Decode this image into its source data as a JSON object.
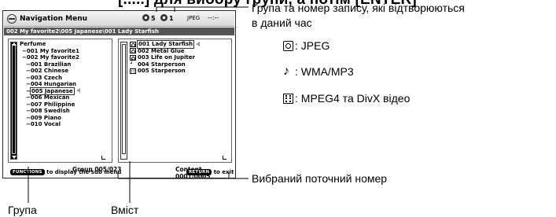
{
  "header_clip": "[.....] для вибору групи, а потім [ENTER]",
  "screen": {
    "title": "Navigation Menu",
    "group_count": "5",
    "track_count": "1",
    "format": "JPEG",
    "time": "--:--",
    "path": "002 My favorite2\\005 Japanese\\001 Lady Starfish",
    "groups": [
      {
        "label": "Perfume",
        "level": 0
      },
      {
        "label": "001 My favorite1",
        "level": 1
      },
      {
        "label": "002 My favorite2",
        "level": 1
      },
      {
        "label": "001 Brazilian",
        "level": 2
      },
      {
        "label": "002 Chinese",
        "level": 2
      },
      {
        "label": "003 Czech",
        "level": 2
      },
      {
        "label": "004 Hungarian",
        "level": 2
      },
      {
        "label": "005 Japanese",
        "level": 2,
        "selected": true
      },
      {
        "label": "006 Mexican",
        "level": 2
      },
      {
        "label": "007 Philippine",
        "level": 2
      },
      {
        "label": "008 Swedish",
        "level": 2
      },
      {
        "label": "009 Piano",
        "level": 2
      },
      {
        "label": "010 Vocal",
        "level": 2
      }
    ],
    "contents": [
      {
        "label": "001 Lady Starfish",
        "type": "jpeg",
        "selected": true
      },
      {
        "label": "002 Metal Glue",
        "type": "jpeg"
      },
      {
        "label": "003 Life on Jupiter",
        "type": "jpeg"
      },
      {
        "label": "004 Starperson",
        "type": "audio"
      },
      {
        "label": "005 Starperson",
        "type": "video"
      }
    ],
    "group_status": "Group 005/023",
    "content_status": "Content 0001/0005",
    "functions_key": "FUNCTIONS",
    "functions_text": "to display the sub menu",
    "return_key": "RETURN",
    "return_text": "to exit"
  },
  "annotations": {
    "playing_line1": "Група та номер запису, які відтворюються",
    "playing_line2": "в даний час",
    "legend": [
      {
        "icon": "jpeg",
        "text": ": JPEG"
      },
      {
        "icon": "audio",
        "text": ": WMA/MP3"
      },
      {
        "icon": "video",
        "text": ": MPEG4 та DivX відео"
      }
    ],
    "selected_number": "Вибраний поточний номер",
    "group_label": "Група",
    "content_label": "Вміст"
  }
}
